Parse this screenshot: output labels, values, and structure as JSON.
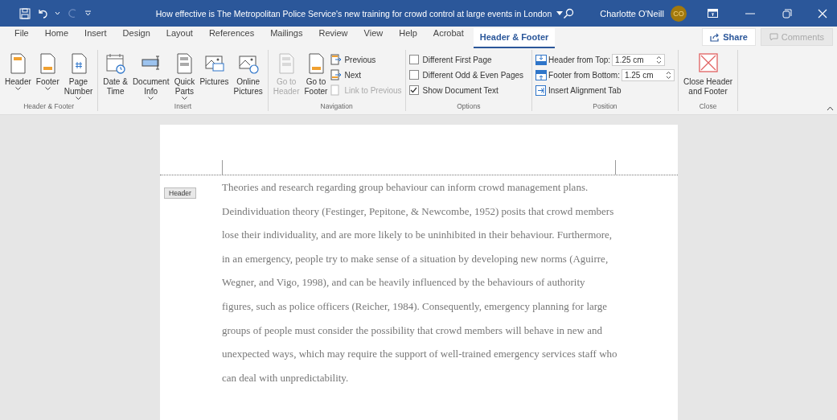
{
  "title_bar": {
    "document_title": "How effective is The Metropolitan Police Service's new training for crowd control at large events in London",
    "user_name": "Charlotte O'Neill",
    "avatar_initials": "CO"
  },
  "tabs": [
    {
      "label": "File",
      "selected": false
    },
    {
      "label": "Home",
      "selected": false
    },
    {
      "label": "Insert",
      "selected": false
    },
    {
      "label": "Design",
      "selected": false
    },
    {
      "label": "Layout",
      "selected": false
    },
    {
      "label": "References",
      "selected": false
    },
    {
      "label": "Mailings",
      "selected": false
    },
    {
      "label": "Review",
      "selected": false
    },
    {
      "label": "View",
      "selected": false
    },
    {
      "label": "Help",
      "selected": false
    },
    {
      "label": "Acrobat",
      "selected": false
    },
    {
      "label": "Header & Footer",
      "selected": true
    }
  ],
  "share_button": {
    "label": "Share"
  },
  "comments_button": {
    "label": "Comments",
    "disabled": true
  },
  "ribbon_groups": [
    {
      "name": "Header & Footer",
      "items": [
        {
          "kind": "large",
          "lines": [
            "Header"
          ],
          "dropdown": true,
          "disabled": false
        },
        {
          "kind": "large",
          "lines": [
            "Footer"
          ],
          "dropdown": true,
          "disabled": false
        },
        {
          "kind": "large",
          "lines": [
            "Page",
            "Number"
          ],
          "dropdown": true,
          "disabled": false
        }
      ]
    },
    {
      "name": "Insert",
      "items": [
        {
          "kind": "large",
          "lines": [
            "Date &",
            "Time"
          ],
          "dropdown": false,
          "disabled": false
        },
        {
          "kind": "large",
          "lines": [
            "Document",
            "Info"
          ],
          "dropdown": true,
          "disabled": false
        },
        {
          "kind": "large",
          "lines": [
            "Quick",
            "Parts"
          ],
          "dropdown": true,
          "disabled": false
        },
        {
          "kind": "large",
          "lines": [
            "Pictures"
          ],
          "dropdown": false,
          "disabled": false
        },
        {
          "kind": "large",
          "lines": [
            "Online",
            "Pictures"
          ],
          "dropdown": false,
          "disabled": false
        }
      ]
    },
    {
      "name": "Navigation",
      "items": [
        {
          "kind": "large",
          "lines": [
            "Go to",
            "Header"
          ],
          "dropdown": false,
          "disabled": true
        },
        {
          "kind": "large",
          "lines": [
            "Go to",
            "Footer"
          ],
          "dropdown": false,
          "disabled": false
        },
        {
          "kind": "stack",
          "items": [
            {
              "label": "Previous",
              "disabled": false
            },
            {
              "label": "Next",
              "disabled": false
            },
            {
              "label": "Link to Previous",
              "disabled": true
            }
          ]
        }
      ]
    },
    {
      "name": "Options",
      "items": [
        {
          "kind": "checks",
          "items": [
            {
              "label": "Different First Page",
              "checked": false
            },
            {
              "label": "Different Odd & Even Pages",
              "checked": false
            },
            {
              "label": "Show Document Text",
              "checked": true
            }
          ]
        }
      ]
    },
    {
      "name": "Position",
      "items": [
        {
          "kind": "position",
          "spins": [
            {
              "label": "Header from Top:",
              "value": "1.25 cm"
            },
            {
              "label": "Footer from Bottom:",
              "value": "1.25 cm"
            }
          ],
          "button": "Insert Alignment Tab"
        }
      ]
    },
    {
      "name": "Close",
      "items": [
        {
          "kind": "large",
          "lines": [
            "Close Header",
            "and Footer"
          ],
          "dropdown": false,
          "disabled": false
        }
      ]
    }
  ],
  "document": {
    "header_tag": "Header",
    "paragraph": "Theories and research regarding group behaviour can inform crowd management plans. Deindividuation theory (Festinger, Pepitone, & Newcombe, 1952) posits that crowd members lose their individuality, and are more likely to be uninhibited in their behaviour. Furthermore, in an emergency, people try to make sense of a situation by developing new norms (Aguirre, Wegner, and Vigo, 1998), and can be heavily influenced by the behaviours of authority figures, such as police officers (Reicher, 1984).  Consequently, emergency planning for large groups of people must consider the possibility that crowd members will behave in new and unexpected ways, which may require the support of well-trained emergency services staff who can deal with unpredictability."
  }
}
